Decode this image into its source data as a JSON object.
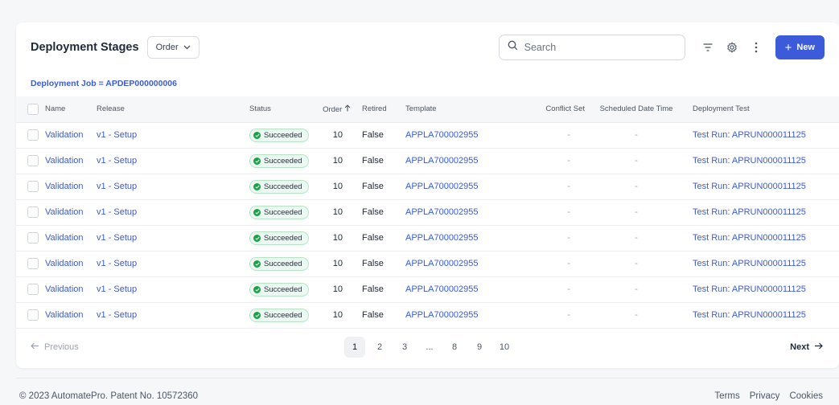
{
  "header": {
    "title": "Deployment Stages",
    "order_select": "Order",
    "search_placeholder": "Search",
    "new_button": "New"
  },
  "filter": "Deployment Job = APDEP000000006",
  "columns": {
    "name": "Name",
    "release": "Release",
    "status": "Status",
    "order": "Order",
    "retired": "Retired",
    "template": "Template",
    "conflict_set": "Conflict Set",
    "scheduled": "Scheduled Date Time",
    "deployment_test": "Deployment Test"
  },
  "rows": [
    {
      "name": "Validation",
      "release": "v1 - Setup",
      "status": "Succeeded",
      "order": "10",
      "retired": "False",
      "template": "APPLA700002955",
      "conflict_set": "-",
      "scheduled": "-",
      "test": "Test Run: APRUN000011125"
    },
    {
      "name": "Validation",
      "release": "v1 - Setup",
      "status": "Succeeded",
      "order": "10",
      "retired": "False",
      "template": "APPLA700002955",
      "conflict_set": "-",
      "scheduled": "-",
      "test": "Test Run: APRUN000011125"
    },
    {
      "name": "Validation",
      "release": "v1 - Setup",
      "status": "Succeeded",
      "order": "10",
      "retired": "False",
      "template": "APPLA700002955",
      "conflict_set": "-",
      "scheduled": "-",
      "test": "Test Run: APRUN000011125"
    },
    {
      "name": "Validation",
      "release": "v1 - Setup",
      "status": "Succeeded",
      "order": "10",
      "retired": "False",
      "template": "APPLA700002955",
      "conflict_set": "-",
      "scheduled": "-",
      "test": "Test Run: APRUN000011125"
    },
    {
      "name": "Validation",
      "release": "v1 - Setup",
      "status": "Succeeded",
      "order": "10",
      "retired": "False",
      "template": "APPLA700002955",
      "conflict_set": "-",
      "scheduled": "-",
      "test": "Test Run: APRUN000011125"
    },
    {
      "name": "Validation",
      "release": "v1 - Setup",
      "status": "Succeeded",
      "order": "10",
      "retired": "False",
      "template": "APPLA700002955",
      "conflict_set": "-",
      "scheduled": "-",
      "test": "Test Run: APRUN000011125"
    },
    {
      "name": "Validation",
      "release": "v1 - Setup",
      "status": "Succeeded",
      "order": "10",
      "retired": "False",
      "template": "APPLA700002955",
      "conflict_set": "-",
      "scheduled": "-",
      "test": "Test Run: APRUN000011125"
    },
    {
      "name": "Validation",
      "release": "v1 - Setup",
      "status": "Succeeded",
      "order": "10",
      "retired": "False",
      "template": "APPLA700002955",
      "conflict_set": "-",
      "scheduled": "-",
      "test": "Test Run: APRUN000011125"
    }
  ],
  "pagination": {
    "previous": "Previous",
    "next": "Next",
    "pages": [
      "1",
      "2",
      "3",
      "...",
      "8",
      "9",
      "10"
    ],
    "active_page": "1"
  },
  "footer": {
    "copyright": "© 2023 AutomatePro. Patent No. 10572360",
    "links": [
      "Terms",
      "Privacy",
      "Cookies"
    ]
  },
  "colors": {
    "accent": "#3b5bdb",
    "success": "#16a34a"
  }
}
